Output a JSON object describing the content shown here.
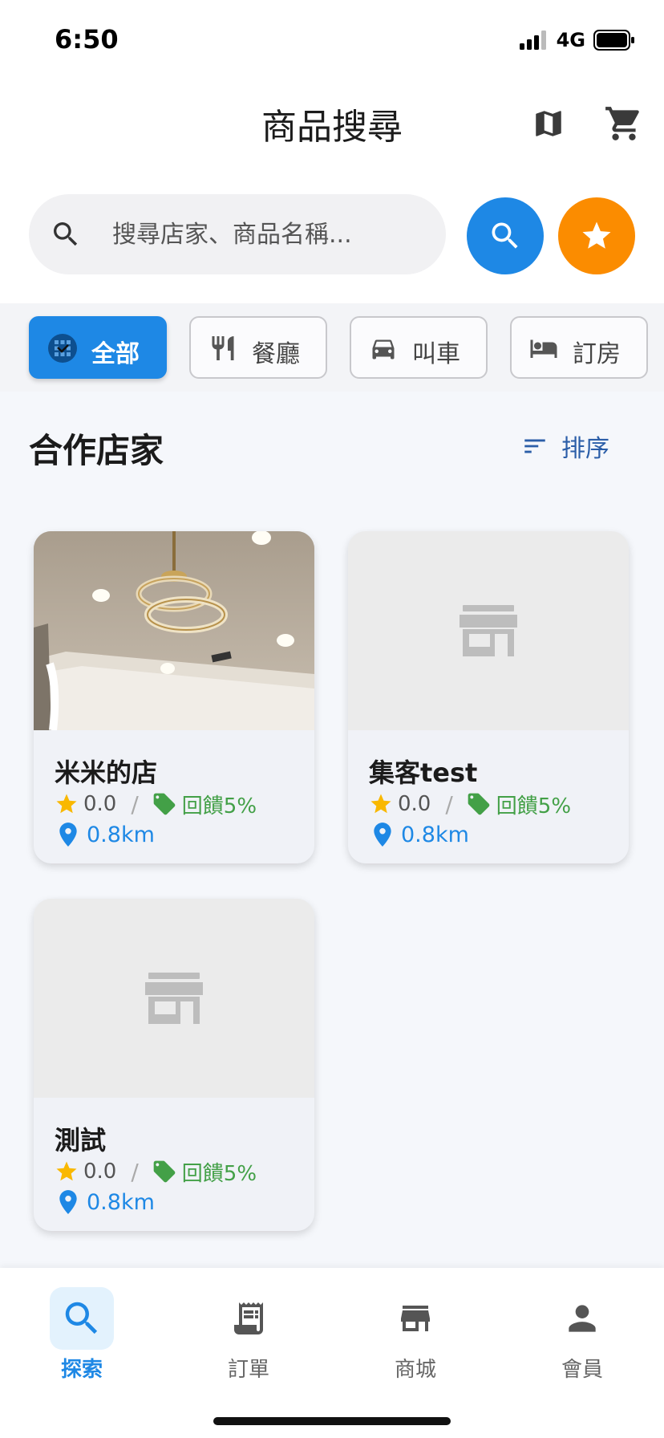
{
  "status": {
    "time": "6:50",
    "network": "4G"
  },
  "header": {
    "title": "商品搜尋",
    "map_icon": "map-icon",
    "cart_icon": "cart-icon"
  },
  "search": {
    "placeholder": "搜尋店家、商品名稱...",
    "value": ""
  },
  "chips": [
    {
      "label": "全部",
      "icon": "grid-icon",
      "active": true
    },
    {
      "label": "餐廳",
      "icon": "restaurant-icon",
      "active": false
    },
    {
      "label": "叫車",
      "icon": "car-icon",
      "active": false
    },
    {
      "label": "訂房",
      "icon": "bed-icon",
      "active": false
    }
  ],
  "section": {
    "title": "合作店家",
    "sort_label": "排序"
  },
  "stores": [
    {
      "name": "米米的店",
      "rating": "0.0",
      "separator": "/",
      "cashback": "回饋5%",
      "distance": "0.8km",
      "has_photo": true
    },
    {
      "name": "集客test",
      "rating": "0.0",
      "separator": "/",
      "cashback": "回饋5%",
      "distance": "0.8km",
      "has_photo": false
    },
    {
      "name": "測試",
      "rating": "0.0",
      "separator": "/",
      "cashback": "回饋5%",
      "distance": "0.8km",
      "has_photo": false
    }
  ],
  "nav": [
    {
      "label": "探索",
      "icon": "search-icon",
      "active": true
    },
    {
      "label": "訂單",
      "icon": "receipt-icon",
      "active": false
    },
    {
      "label": "商城",
      "icon": "store-icon",
      "active": false
    },
    {
      "label": "會員",
      "icon": "person-icon",
      "active": false
    }
  ],
  "colors": {
    "primary": "#1e88e5",
    "accent": "#fb8c00",
    "star": "#f9b800",
    "cashback": "#43a047"
  }
}
